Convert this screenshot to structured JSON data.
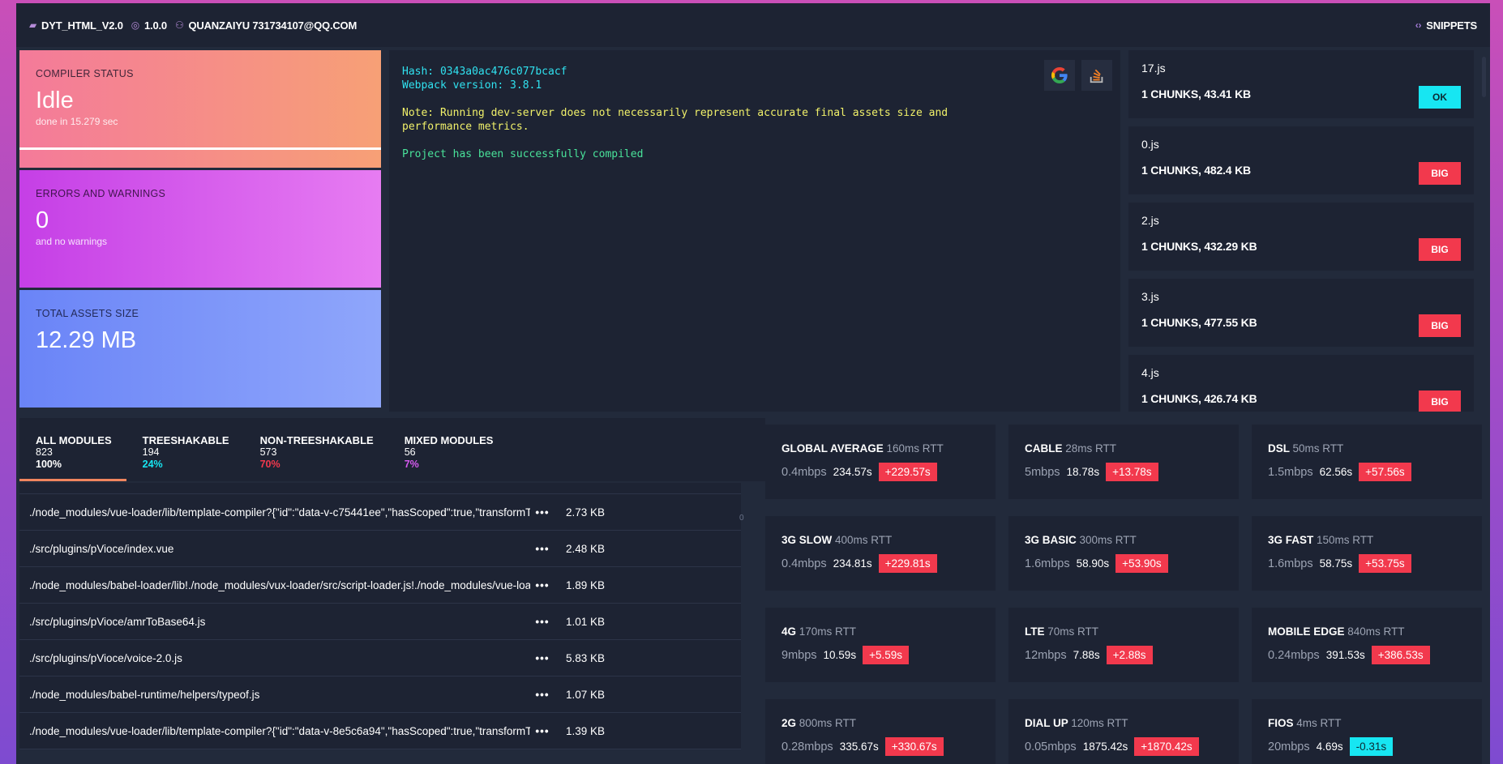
{
  "topbar": {
    "project": "DYT_HTML_V2.0",
    "version": "1.0.0",
    "user": "QUANZAIYU 731734107@QQ.COM",
    "snippets": "SNIPPETS"
  },
  "status": {
    "compiler": {
      "label": "COMPILER STATUS",
      "value": "Idle",
      "sub": "done in 15.279 sec"
    },
    "errors": {
      "label": "ERRORS AND WARNINGS",
      "value": "0",
      "sub": "and no warnings"
    },
    "assets": {
      "label": "TOTAL ASSETS SIZE",
      "value": "12.29 MB"
    }
  },
  "log": {
    "hash": "Hash: 0343a0ac476c077bcacf",
    "webpack": "Webpack version: 3.8.1",
    "note": "Note: Running dev-server does not necessarily represent accurate final assets size and performance metrics.",
    "success": "Project has been successfully compiled"
  },
  "assets": [
    {
      "name": "17.js",
      "info": "1 CHUNKS, 43.41 KB",
      "badge": "OK"
    },
    {
      "name": "0.js",
      "info": "1 CHUNKS, 482.4 KB",
      "badge": "BIG"
    },
    {
      "name": "2.js",
      "info": "1 CHUNKS, 432.29 KB",
      "badge": "BIG"
    },
    {
      "name": "3.js",
      "info": "1 CHUNKS, 477.55 KB",
      "badge": "BIG"
    },
    {
      "name": "4.js",
      "info": "1 CHUNKS, 426.74 KB",
      "badge": "BIG"
    }
  ],
  "module_tabs": [
    {
      "title": "ALL MODULES",
      "count": "823",
      "percent": "100%",
      "color": "#ffffff"
    },
    {
      "title": "TREESHAKABLE",
      "count": "194",
      "percent": "24%",
      "color": "#17e6f2"
    },
    {
      "title": "NON-TREESHAKABLE",
      "count": "573",
      "percent": "70%",
      "color": "#f2394d"
    },
    {
      "title": "MIXED MODULES",
      "count": "56",
      "percent": "7%",
      "color": "#d65bf0"
    }
  ],
  "modules": [
    {
      "path": "./node_modules/vue-loader/lib/template-compiler?{\"id\":\"data-v-c75441ee\",\"hasScoped\":true,\"transformToRequire\"",
      "size": "2.73 KB"
    },
    {
      "path": "./src/plugins/pVioce/index.vue",
      "size": "2.48 KB"
    },
    {
      "path": "./node_modules/babel-loader/lib!./node_modules/vux-loader/src/script-loader.js!./node_modules/vue-loader",
      "size": "1.89 KB"
    },
    {
      "path": "./src/plugins/pVioce/amrToBase64.js",
      "size": "1.01 KB"
    },
    {
      "path": "./src/plugins/pVioce/voice-2.0.js",
      "size": "5.83 KB"
    },
    {
      "path": "./node_modules/babel-runtime/helpers/typeof.js",
      "size": "1.07 KB"
    },
    {
      "path": "./node_modules/vue-loader/lib/template-compiler?{\"id\":\"data-v-8e5c6a94\",\"hasScoped\":true,\"transformToRequire\"",
      "size": "1.39 KB"
    }
  ],
  "modules_extra": {
    "zero": "0",
    "dots": "•••"
  },
  "networks": [
    {
      "name": "GLOBAL AVERAGE",
      "rtt": "160ms RTT",
      "speed": "0.4mbps",
      "time": "234.57s",
      "delta": "+229.57s",
      "kind": "red"
    },
    {
      "name": "CABLE",
      "rtt": "28ms RTT",
      "speed": "5mbps",
      "time": "18.78s",
      "delta": "+13.78s",
      "kind": "red"
    },
    {
      "name": "DSL",
      "rtt": "50ms RTT",
      "speed": "1.5mbps",
      "time": "62.56s",
      "delta": "+57.56s",
      "kind": "red"
    },
    {
      "name": "3G SLOW",
      "rtt": "400ms RTT",
      "speed": "0.4mbps",
      "time": "234.81s",
      "delta": "+229.81s",
      "kind": "red"
    },
    {
      "name": "3G BASIC",
      "rtt": "300ms RTT",
      "speed": "1.6mbps",
      "time": "58.90s",
      "delta": "+53.90s",
      "kind": "red"
    },
    {
      "name": "3G FAST",
      "rtt": "150ms RTT",
      "speed": "1.6mbps",
      "time": "58.75s",
      "delta": "+53.75s",
      "kind": "red"
    },
    {
      "name": "4G",
      "rtt": "170ms RTT",
      "speed": "9mbps",
      "time": "10.59s",
      "delta": "+5.59s",
      "kind": "red"
    },
    {
      "name": "LTE",
      "rtt": "70ms RTT",
      "speed": "12mbps",
      "time": "7.88s",
      "delta": "+2.88s",
      "kind": "red"
    },
    {
      "name": "MOBILE EDGE",
      "rtt": "840ms RTT",
      "speed": "0.24mbps",
      "time": "391.53s",
      "delta": "+386.53s",
      "kind": "red"
    },
    {
      "name": "2G",
      "rtt": "800ms RTT",
      "speed": "0.28mbps",
      "time": "335.67s",
      "delta": "+330.67s",
      "kind": "red"
    },
    {
      "name": "DIAL UP",
      "rtt": "120ms RTT",
      "speed": "0.05mbps",
      "time": "1875.42s",
      "delta": "+1870.42s",
      "kind": "red"
    },
    {
      "name": "FIOS",
      "rtt": "4ms RTT",
      "speed": "20mbps",
      "time": "4.69s",
      "delta": "-0.31s",
      "kind": "cyan"
    }
  ]
}
